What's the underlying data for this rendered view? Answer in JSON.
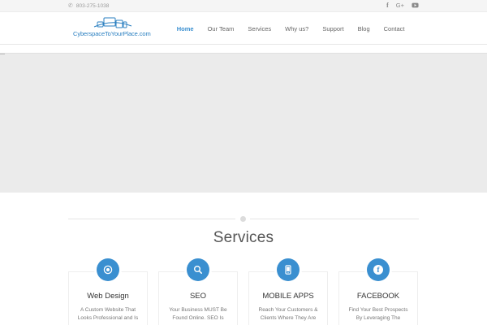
{
  "topbar": {
    "phone": "803-275-1038",
    "social_icons": [
      "facebook-icon",
      "google-plus-icon",
      "youtube-icon"
    ],
    "facebook_glyph": "f",
    "google_plus_glyph": "G+"
  },
  "header": {
    "logo_text": "CyberspaceToYourPlace.com",
    "nav": [
      {
        "label": "Home",
        "active": true
      },
      {
        "label": "Our Team",
        "active": false
      },
      {
        "label": "Services",
        "active": false
      },
      {
        "label": "Why us?",
        "active": false
      },
      {
        "label": "Support",
        "active": false
      },
      {
        "label": "Blog",
        "active": false
      },
      {
        "label": "Contact",
        "active": false
      }
    ]
  },
  "colors": {
    "accent": "#3a8fd0",
    "topbar_bg": "#f5f5f5",
    "hero_bg": "#ebebeb"
  },
  "services": {
    "title": "Services",
    "cards": [
      {
        "title": "Web Design",
        "icon": "eye-icon",
        "desc_line1": "A Custom Website That",
        "desc_line2": "Looks Professional and Is"
      },
      {
        "title": "SEO",
        "icon": "search-icon",
        "desc_line1": "Your Business MUST Be",
        "desc_line2": "Found Online. SEO Is"
      },
      {
        "title": "MOBILE APPS",
        "icon": "mobile-icon",
        "desc_line1": "Reach Your Customers &",
        "desc_line2": "Clients Where They Are"
      },
      {
        "title": "FACEBOOK",
        "icon": "facebook-icon",
        "icon_glyph": "f",
        "desc_line1": "Find Your Best Prospects",
        "desc_line2": "By Leveraging The"
      }
    ]
  }
}
